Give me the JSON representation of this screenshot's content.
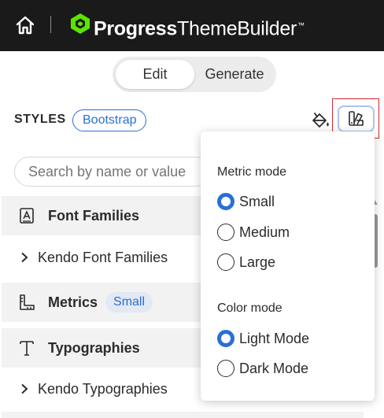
{
  "header": {
    "brand_bold": "Progress",
    "brand_light": "ThemeBuilder",
    "brand_mark": "™",
    "home_icon": "home-icon",
    "logo_icon": "progress-logo-icon",
    "background": "#1a1a1a"
  },
  "mode_toggle": {
    "edit_label": "Edit",
    "generate_label": "Generate",
    "selected": "Edit"
  },
  "styles_bar": {
    "label": "STYLES",
    "theme_chip": "Bootstrap",
    "reset_icon": "paint-bucket-icon",
    "swatch_icon": "color-swatch-icon"
  },
  "search": {
    "placeholder": "Search by name or value"
  },
  "style_list": [
    {
      "label": "Font Families",
      "icon": "font-family-icon",
      "type": "group"
    },
    {
      "label": "Kendo Font Families",
      "icon": "chevron-right-icon",
      "type": "subgroup"
    },
    {
      "label": "Metrics",
      "icon": "ruler-icon",
      "type": "group",
      "badge": "Small"
    },
    {
      "label": "Typographies",
      "icon": "typography-icon",
      "type": "group"
    },
    {
      "label": "Kendo Typographies",
      "icon": "chevron-right-icon",
      "type": "subgroup"
    }
  ],
  "popup": {
    "metric_title": "Metric mode",
    "metric_options": [
      "Small",
      "Medium",
      "Large"
    ],
    "metric_selected": "Small",
    "color_title": "Color mode",
    "color_options": [
      "Light Mode",
      "Dark Mode"
    ],
    "color_selected": "Light Mode"
  },
  "colors": {
    "accent": "#2a6fd6",
    "brand_green": "#5ce500",
    "highlight_border": "#d9262c"
  }
}
